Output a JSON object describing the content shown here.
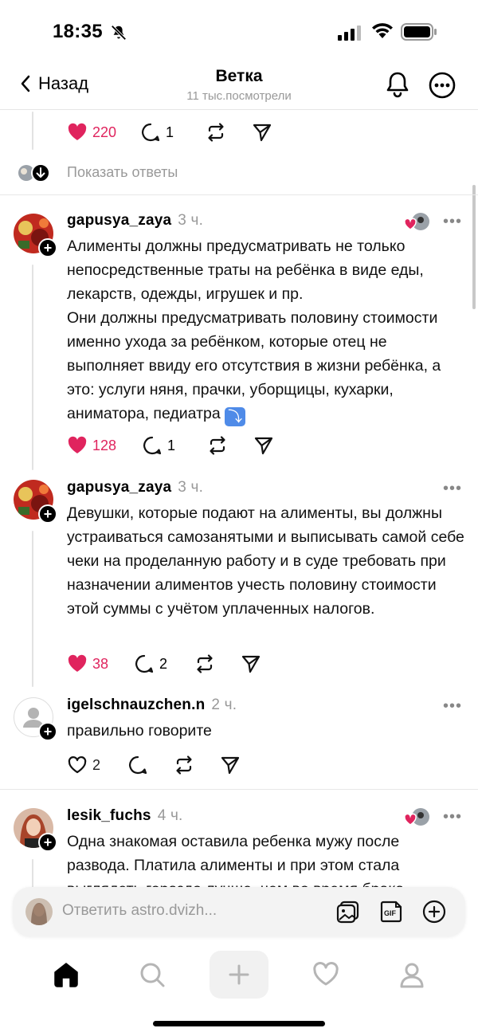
{
  "status_bar": {
    "time": "18:35"
  },
  "header": {
    "back_label": "Назад",
    "title": "Ветка",
    "subtitle": "11 тыс.посмотрели"
  },
  "top_post_actions": {
    "likes": "220",
    "replies": "1"
  },
  "show_replies_label": "Показать ответы",
  "posts": [
    {
      "username": "gapusya_zaya",
      "time": "3 ч.",
      "paragraphs": [
        "Алименты должны предусматривать не только непосредственные траты на ребёнка в виде еды, лекарств, одежды, игрушек и пр.",
        "Они должны предусматривать половину стоимости именно ухода за ребёнком, которые отец не выполняет ввиду его отсутствия в жизни ребёнка, а это: услуги няня, прачки, уборщицы, кухарки, аниматора, педиатра"
      ],
      "likes": "128",
      "replies": "1"
    },
    {
      "username": "gapusya_zaya",
      "time": "3 ч.",
      "paragraphs": [
        "Девушки, которые подают на алименты, вы должны устраиваться самозанятыми и выписывать самой себе чеки на проделанную работу и в суде требовать при назначении алиментов учесть половину стоимости этой суммы с учётом уплаченных налогов."
      ],
      "likes": "38",
      "replies": "2"
    },
    {
      "username": "igelschnauzchen.n",
      "time": "2 ч.",
      "paragraphs": [
        "правильно говорите"
      ],
      "likes": "2",
      "replies": ""
    },
    {
      "username": "lesik_fuchs",
      "time": "4 ч.",
      "paragraphs": [
        "Одна знакомая оставила ребенка мужу после развода. Платила алименты и при этом стала выглядеть гораздо лучше, чем во время брака"
      ]
    }
  ],
  "reply_bar": {
    "placeholder": "Ответить astro.dvizh..."
  },
  "colors": {
    "like": "#e0245e",
    "text": "#000000",
    "muted": "#999999"
  },
  "icons": [
    "mute-icon",
    "signal-icon",
    "wifi-icon",
    "battery-icon",
    "chevron-left-icon",
    "bell-icon",
    "more-icon",
    "heart-icon",
    "comment-icon",
    "repost-icon",
    "share-icon",
    "image-icon",
    "gif-icon",
    "plus-circle-icon",
    "home-icon",
    "search-icon",
    "plus-icon",
    "person-icon"
  ]
}
